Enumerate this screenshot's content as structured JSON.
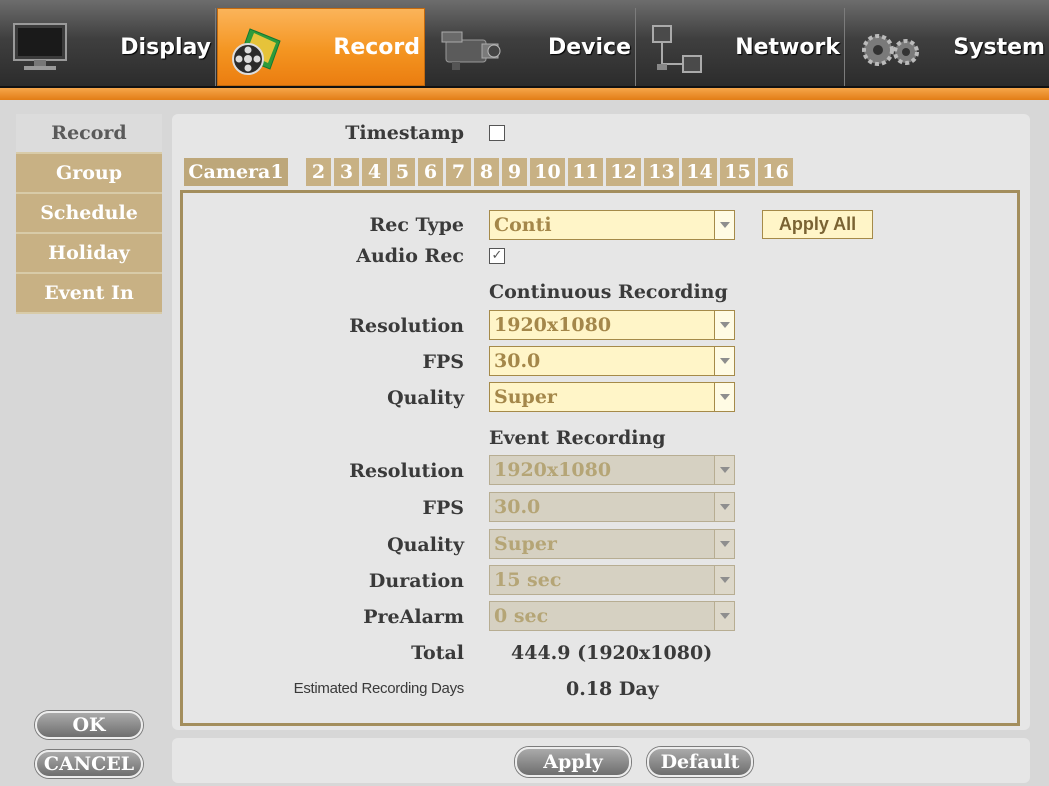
{
  "topnav": {
    "tabs": [
      {
        "label": "Display",
        "icon": "monitor-icon"
      },
      {
        "label": "Record",
        "icon": "film-reel-icon",
        "active": true
      },
      {
        "label": "Device",
        "icon": "camcorder-icon"
      },
      {
        "label": "Network",
        "icon": "network-icon"
      },
      {
        "label": "System",
        "icon": "gears-icon"
      }
    ],
    "accent": "#f49521"
  },
  "sidebar": {
    "items": [
      {
        "label": "Record",
        "active": true
      },
      {
        "label": "Group"
      },
      {
        "label": "Schedule"
      },
      {
        "label": "Holiday"
      },
      {
        "label": "Event In"
      }
    ],
    "ok_label": "OK",
    "cancel_label": "CANCEL"
  },
  "main": {
    "timestamp_label": "Timestamp",
    "timestamp_checked": false,
    "camera_tabs": [
      "Camera1",
      "2",
      "3",
      "4",
      "5",
      "6",
      "7",
      "8",
      "9",
      "10",
      "11",
      "12",
      "13",
      "14",
      "15",
      "16"
    ],
    "rec_type_label": "Rec Type",
    "rec_type_value": "Conti",
    "apply_all_label": "Apply All",
    "audio_rec_label": "Audio Rec",
    "audio_rec_checked": true,
    "continuous": {
      "heading": "Continuous Recording",
      "resolution_label": "Resolution",
      "resolution_value": "1920x1080",
      "fps_label": "FPS",
      "fps_value": "30.0",
      "quality_label": "Quality",
      "quality_value": "Super"
    },
    "event": {
      "heading": "Event Recording",
      "resolution_label": "Resolution",
      "resolution_value": "1920x1080",
      "fps_label": "FPS",
      "fps_value": "30.0",
      "quality_label": "Quality",
      "quality_value": "Super",
      "duration_label": "Duration",
      "duration_value": "15 sec",
      "prealarm_label": "PreAlarm",
      "prealarm_value": "0 sec"
    },
    "total_label": "Total",
    "total_value": "444.9 (1920x1080)",
    "est_days_label": "Estimated Recording Days",
    "est_days_value": "0.18 Day"
  },
  "footer": {
    "apply_label": "Apply",
    "default_label": "Default"
  }
}
